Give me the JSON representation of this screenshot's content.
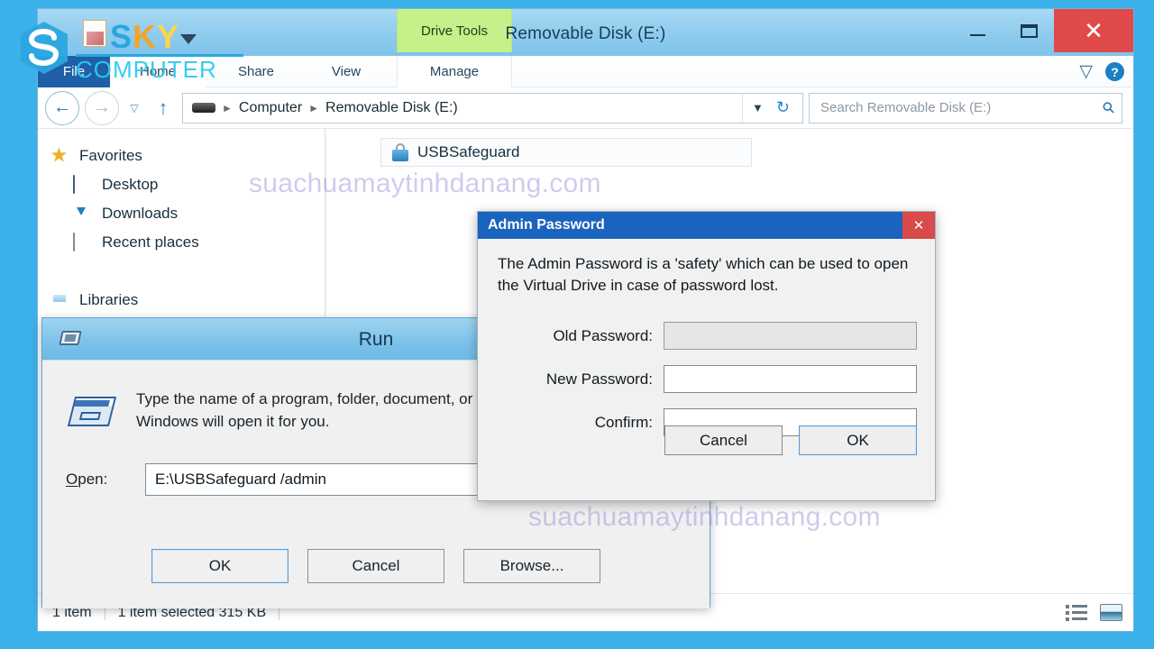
{
  "explorer": {
    "title": "Removable Disk (E:)",
    "contextual_tab": "Drive Tools",
    "window_controls": {
      "minimize": "minimize-button",
      "maximize": "maximize-button",
      "close": "close-button"
    },
    "ribbon_tabs": [
      {
        "label": "File"
      },
      {
        "label": "Home"
      },
      {
        "label": "Share"
      },
      {
        "label": "View"
      },
      {
        "label": "Manage"
      }
    ],
    "ribbon_right": {
      "expand": "chevron-down-icon",
      "help": "?"
    },
    "address_bar": {
      "back": "back-arrow-icon",
      "forward": "forward-arrow-icon",
      "history": "recent-locations-icon",
      "up": "up-arrow-icon",
      "breadcrumbs": [
        "Computer",
        "Removable Disk (E:)"
      ],
      "dropdown": "chevron-down-icon",
      "refresh": "refresh-icon"
    },
    "search": {
      "placeholder": "Search Removable Disk (E:)",
      "icon": "search-icon"
    },
    "navigation_pane": [
      {
        "label": "Favorites",
        "icon": "star-icon",
        "level": 0
      },
      {
        "label": "Desktop",
        "icon": "desktop-icon",
        "level": 1
      },
      {
        "label": "Downloads",
        "icon": "downloads-folder-icon",
        "level": 1
      },
      {
        "label": "Recent places",
        "icon": "recent-places-icon",
        "level": 1
      },
      {
        "label": "Libraries",
        "icon": "libraries-folder-icon",
        "level": 0
      }
    ],
    "files": [
      {
        "name": "USBSafeguard",
        "icon": "lock-icon"
      }
    ],
    "status_bar": {
      "item_count": "1 item",
      "selection": "1 item selected  315 KB",
      "view_details": "details-view-icon",
      "view_tiles": "large-icons-view-icon"
    }
  },
  "run_dialog": {
    "title": "Run",
    "icon": "run-window-icon",
    "description": "Type the name of a program, folder, document, or Internet resource, and Windows will open it for you.",
    "open_label_prefix": "O",
    "open_label_rest": "pen:",
    "open_value": "E:\\USBSafeguard /admin",
    "buttons": [
      {
        "label": "OK",
        "default": true
      },
      {
        "label": "Cancel",
        "default": false
      },
      {
        "label": "Browse...",
        "default": false
      }
    ]
  },
  "admin_dialog": {
    "title": "Admin Password",
    "close": "close-icon",
    "description": "The Admin Password is a 'safety' which can be used to open the Virtual Drive in case of password lost.",
    "fields": [
      {
        "label": "Old Password:",
        "value": "",
        "disabled": true
      },
      {
        "label": "New Password:",
        "value": "",
        "disabled": false
      },
      {
        "label": "Confirm:",
        "value": "",
        "disabled": false
      }
    ],
    "buttons": [
      {
        "label": "Cancel",
        "default": false
      },
      {
        "label": "OK",
        "default": true
      }
    ]
  },
  "watermarks": {
    "text": "suachuamaytinhdanang.com"
  },
  "logo": {
    "s": "S",
    "k": "K",
    "y": "Y",
    "subtitle": "COMPUTER"
  },
  "colors": {
    "desktop": "#3cb0e8",
    "titlebar": "#8ecbee",
    "file_tab": "#1f5fa8",
    "drive_tools": "#c6f08a",
    "close_red": "#e04a4a",
    "admin_title_blue": "#1a63bf",
    "watermark": "#8e86d6",
    "logo_blue": "#2aa7e0"
  }
}
